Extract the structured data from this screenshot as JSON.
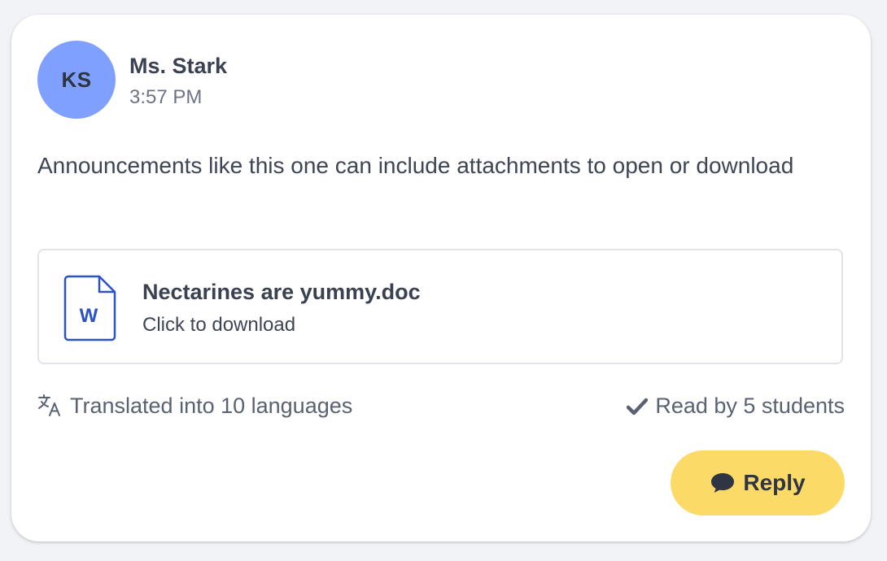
{
  "post": {
    "avatar_initials": "KS",
    "author": "Ms. Stark",
    "time": "3:57 PM",
    "body": "Announcements like this one can include attachments to open or download"
  },
  "attachment": {
    "icon_letter": "W",
    "file_name": "Nectarines are yummy.doc",
    "subtitle": "Click to download"
  },
  "footer": {
    "translated_label": "Translated into 10 languages",
    "read_label": "Read by 5 students"
  },
  "reply_button": {
    "label": "Reply"
  },
  "colors": {
    "avatar_bg": "#7fa0ff",
    "reply_bg": "#fcda68",
    "word_icon": "#2b52c7"
  }
}
